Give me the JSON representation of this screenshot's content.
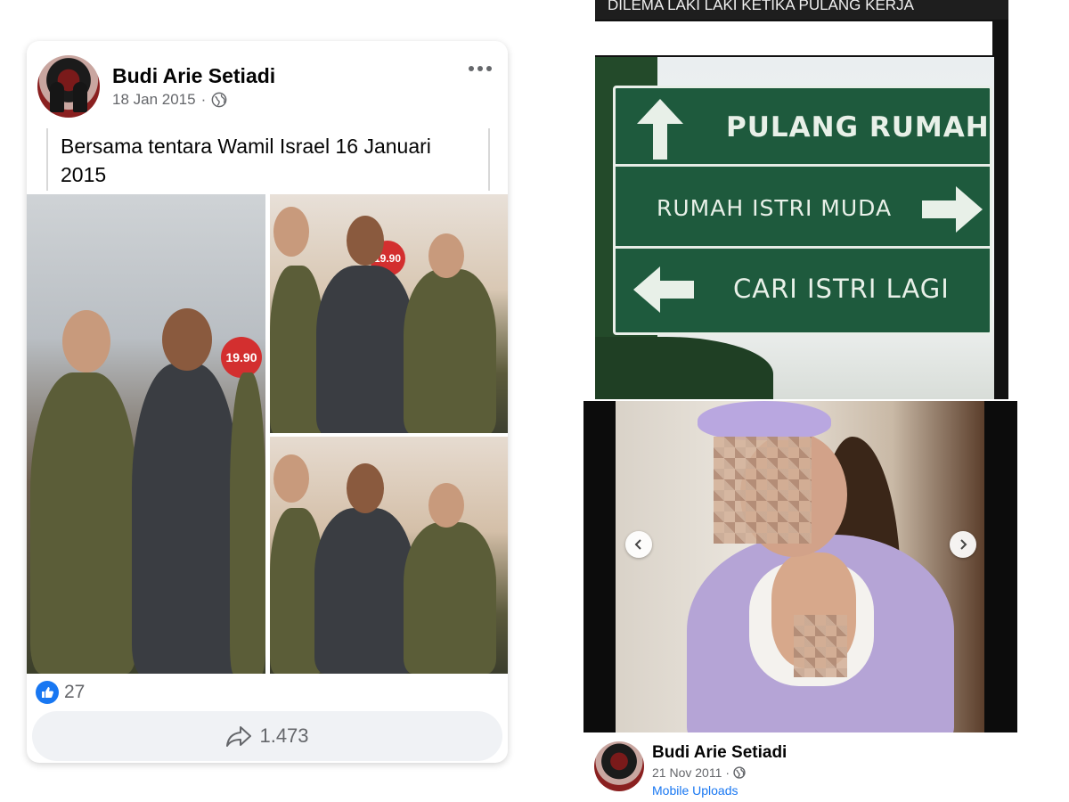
{
  "left_post": {
    "author": "Budi Arie Setiadi",
    "date": "18 Jan 2015",
    "separator": "·",
    "privacy_icon": "globe-icon",
    "more_icon": "more-horizontal-icon",
    "caption": "Bersama tentara Wamil Israel 16 Januari 2015",
    "photos": [
      {
        "name": "photo-main",
        "sign_text": "19.90"
      },
      {
        "name": "photo-top",
        "sign_text": "19.90"
      },
      {
        "name": "photo-bottom",
        "sign_text": ""
      }
    ],
    "like_count": "27",
    "share_count": "1.473",
    "colors": {
      "like_blue": "#1877f2",
      "meta_gray": "#65676b",
      "share_bg": "#f0f2f5"
    }
  },
  "meme": {
    "title": "DILEMA LAKI LAKI KETIKA PULANG KERJA",
    "sign_rows": [
      {
        "text": "PULANG RUMAH",
        "arrow": "up"
      },
      {
        "text": "RUMAH ISTRI MUDA",
        "arrow": "right"
      },
      {
        "text": "CARI ISTRI LAGI",
        "arrow": "left"
      }
    ],
    "colors": {
      "sign_green": "#1e5a3d"
    }
  },
  "right_post": {
    "author": "Budi Arie Setiadi",
    "date": "21 Nov 2011",
    "separator": "·",
    "privacy_icon": "globe-icon",
    "album": "Mobile Uploads",
    "prev_icon": "chevron-left-icon",
    "next_icon": "chevron-right-icon"
  }
}
